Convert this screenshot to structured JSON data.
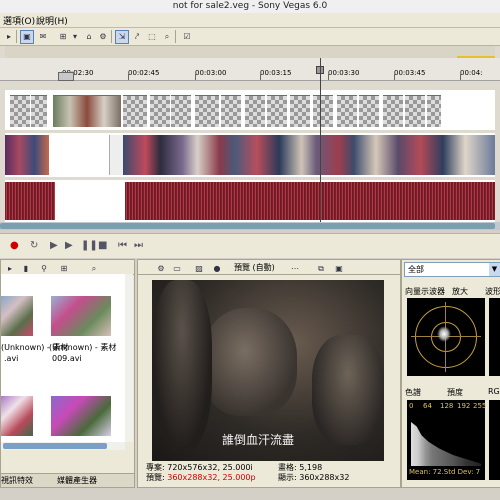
{
  "window": {
    "title": "not for sale2.veg - Sony Vegas 6.0"
  },
  "menubar": {
    "items": [
      {
        "label": "選項(O)"
      },
      {
        "label": "說明(H)"
      }
    ]
  },
  "timeline": {
    "ruler_labels": [
      "00:02:30",
      "00:02:45",
      "00:03:00",
      "00:03:15",
      "00:03:30",
      "00:03:45",
      "00:04:"
    ]
  },
  "transport": {
    "icons": [
      "record-icon",
      "loop-icon",
      "play-from-start-icon",
      "play-icon",
      "pause-icon",
      "stop-icon",
      "prev-marker-icon",
      "next-marker-icon"
    ]
  },
  "explorer": {
    "items": [
      {
        "caption": "(Unknown) - 素材",
        "ext": ".avi"
      },
      {
        "caption": "(Unknown) - 素材",
        "ext": "009.avi"
      }
    ],
    "tabs": [
      "視訊特效",
      "媒體產生器"
    ]
  },
  "preview": {
    "mode_label": "預覽 (自動)",
    "subtitle": "誰倒血汗流盡",
    "info": {
      "project_label": "專案:",
      "project_value": "720x576x32, 25.000i",
      "preview_label": "預覽:",
      "preview_value": "360x288x32, 25.000p",
      "frame_label": "畫格:",
      "frame_value": "5,198",
      "display_label": "顯示:",
      "display_value": "360x288x32"
    }
  },
  "scope": {
    "dropdown": "全部",
    "labels": {
      "vectorscope": "向量示波器",
      "zoom": "放大",
      "waveform": "波形",
      "histogram": "色譜",
      "brightness": "預度",
      "rgb": "RGE"
    },
    "hist_ticks": [
      "0",
      "64",
      "128",
      "192",
      "255"
    ],
    "hist_stats": "Mean: 72.Std Dev: 7"
  }
}
